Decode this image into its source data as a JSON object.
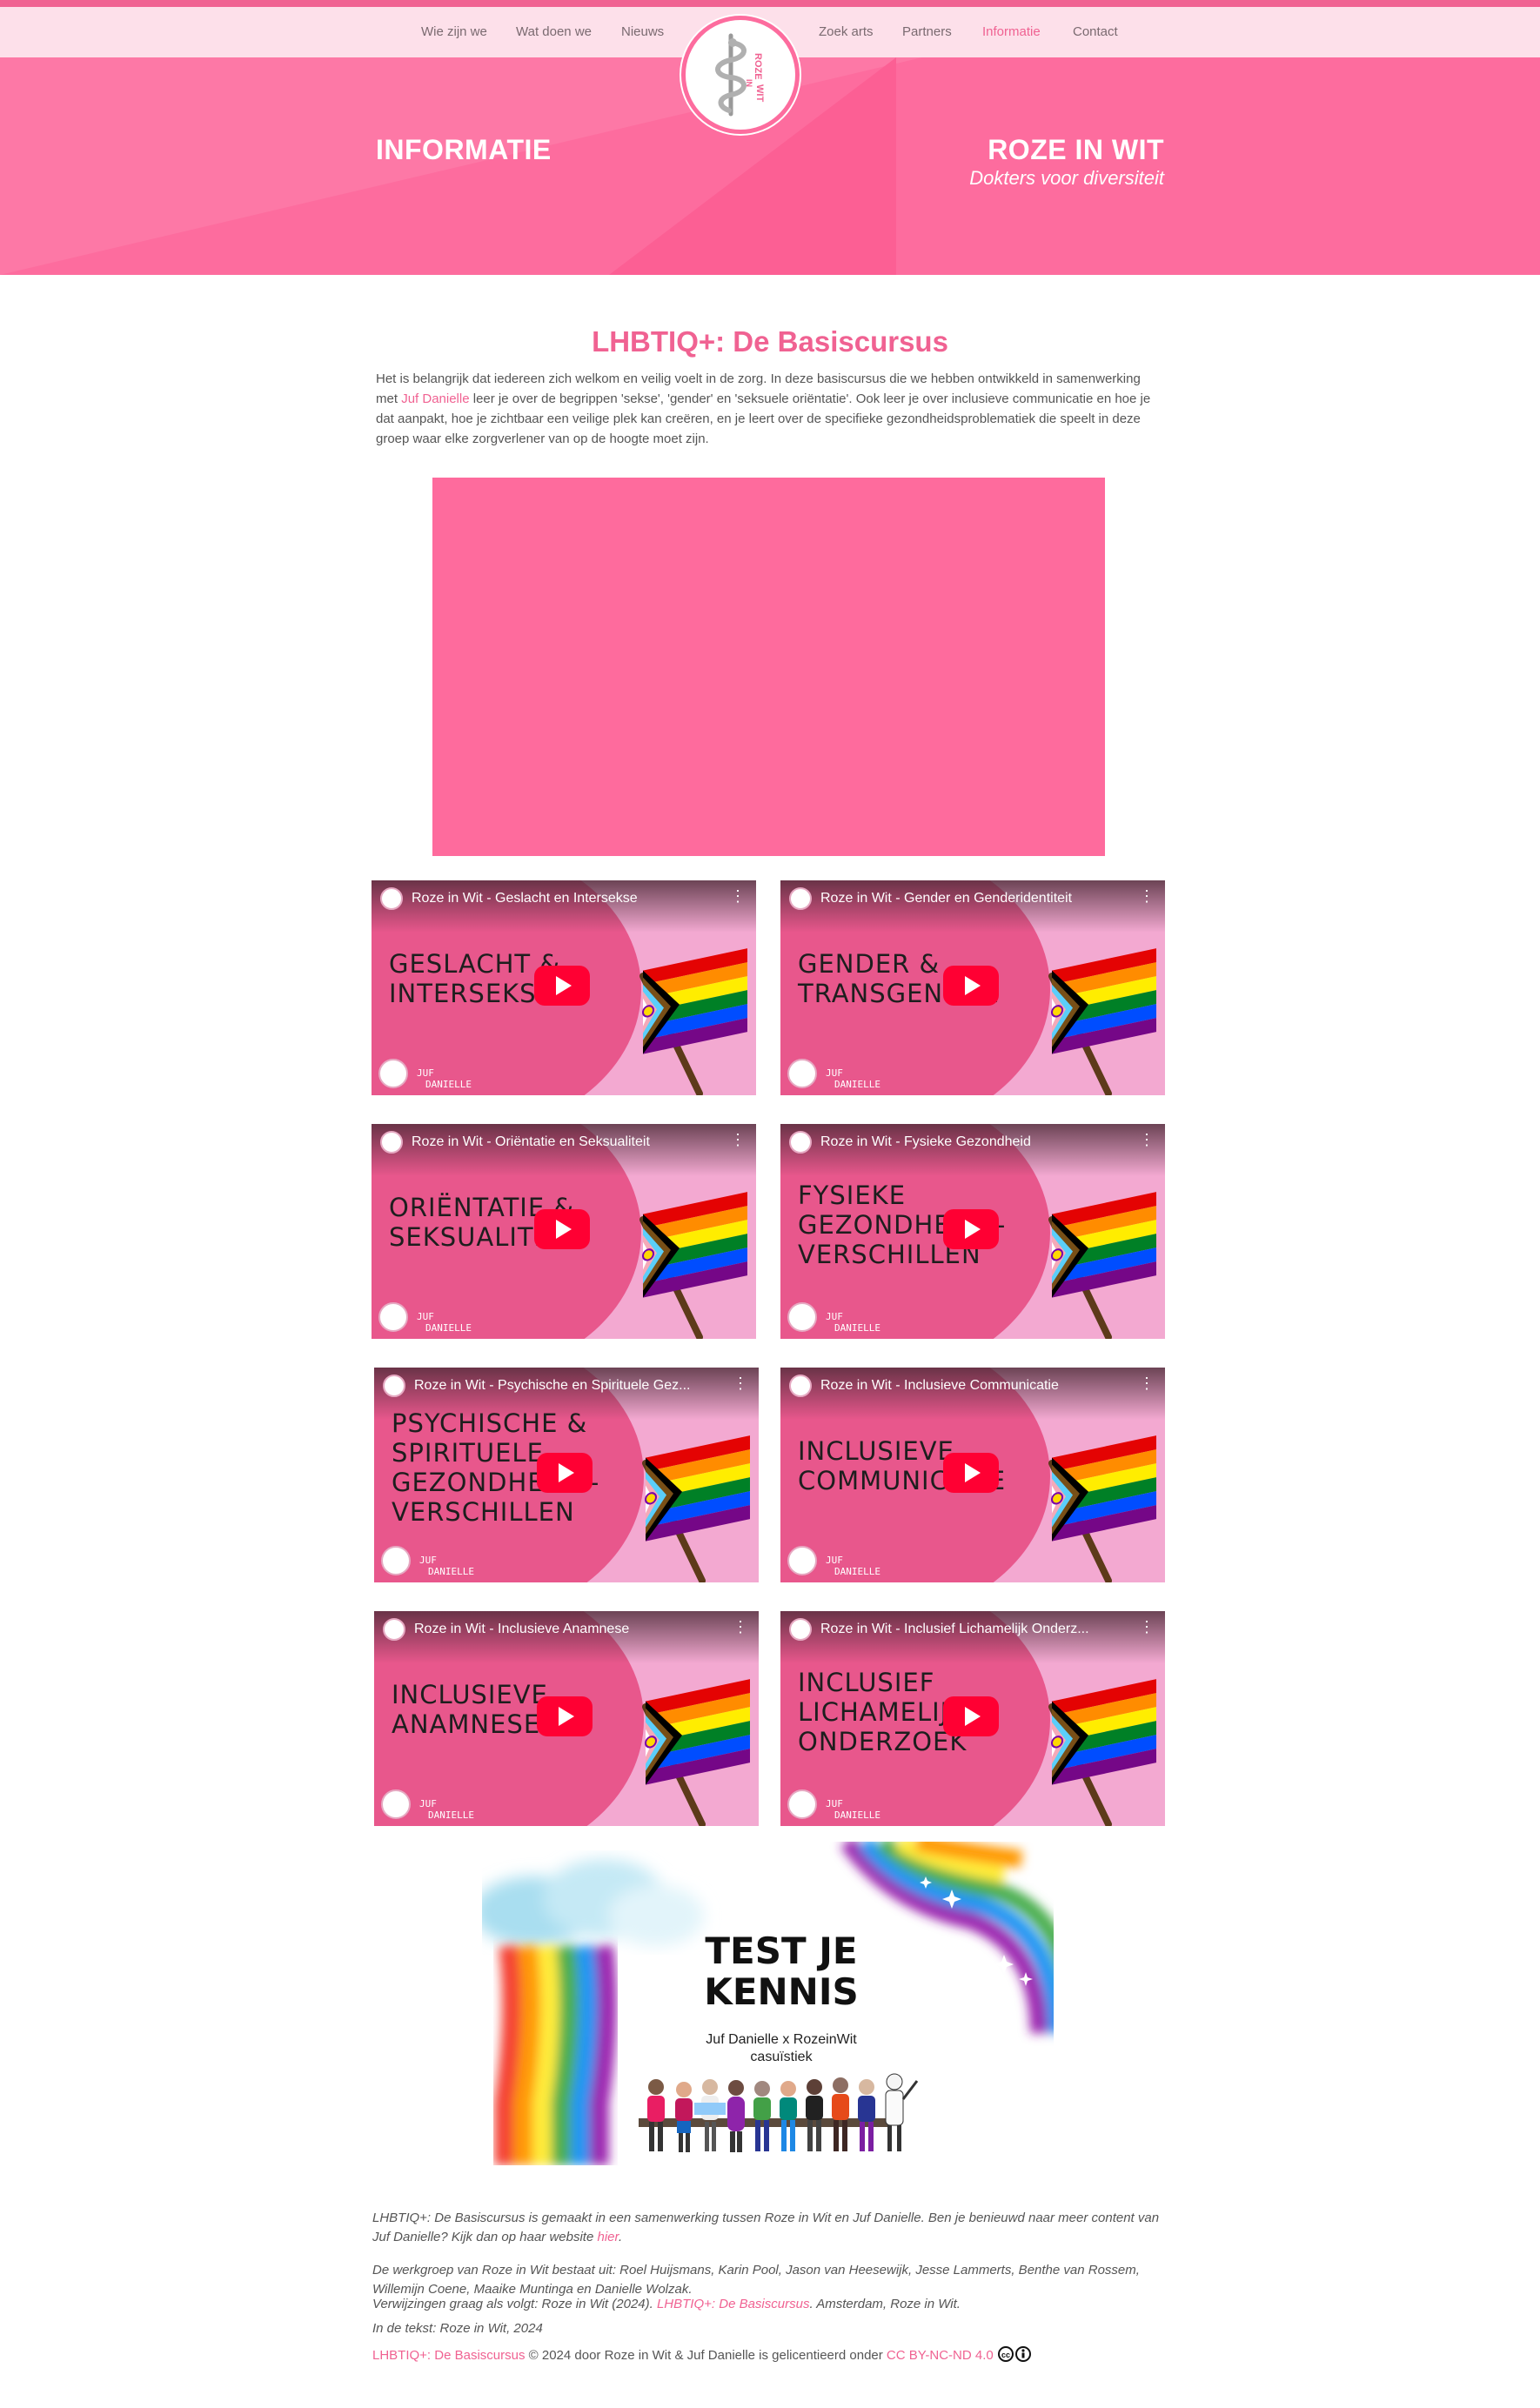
{
  "nav": {
    "left": [
      "Wie zijn we",
      "Wat doen we",
      "Nieuws"
    ],
    "right": [
      "Zoek arts",
      "Partners",
      "Informatie",
      "Contact"
    ],
    "active": "Informatie"
  },
  "logo": {
    "text_top": "ROZE",
    "text_mid": "IN",
    "text_bottom": "WIT"
  },
  "hero": {
    "left_title": "INFORMATIE",
    "right_title": "ROZE IN WIT",
    "right_subtitle": "Dokters voor diversiteit"
  },
  "colors": {
    "accent": "#f06292",
    "hero": "#fd6c9e",
    "nav_bg": "#fde0ea"
  },
  "main": {
    "title": "LHBTIQ+: De Basiscursus",
    "intro_before": "Het is belangrijk dat iedereen zich welkom en veilig voelt in de zorg. In deze basiscursus die we hebben ontwikkeld in samenwerking met ",
    "intro_link": "Juf Danielle",
    "intro_after": " leer je over de begrippen 'sekse', 'gender' en 'seksuele oriëntatie'. Ook leer je over inclusieve communicatie en hoe je dat aanpakt, hoe je zichtbaar een veilige plek kan creëren, en je leert over de specifieke gezondheidsproblematiek die speelt in deze groep waar elke zorgverlener van op de hoogte moet zijn."
  },
  "videos": [
    {
      "title": "Roze in Wit - Geslacht en Intersekse",
      "lines": [
        "GESLACHT &",
        "INTERSEKSE"
      ]
    },
    {
      "title": "Roze in Wit - Gender en Genderidentiteit",
      "lines": [
        "GENDER &",
        "TRANSGENDER"
      ]
    },
    {
      "title": "Roze in Wit - Oriëntatie en Seksualiteit",
      "lines": [
        "ORIËNTATIE &",
        "SEKSUALITEIT"
      ]
    },
    {
      "title": "Roze in Wit - Fysieke Gezondheid",
      "lines": [
        "FYSIEKE",
        "GEZONDHEIDS-",
        "VERSCHILLEN"
      ]
    },
    {
      "title": "Roze in Wit - Psychische en Spirituele Gez...",
      "lines": [
        "PSYCHISCHE &",
        "SPIRITUELE",
        "GEZONDHEIDS-",
        "VERSCHILLEN"
      ]
    },
    {
      "title": "Roze in Wit - Inclusieve Communicatie",
      "lines": [
        "INCLUSIEVE",
        "COMMUNICATIE"
      ]
    },
    {
      "title": "Roze in Wit - Inclusieve Anamnese",
      "lines": [
        "INCLUSIEVE",
        "ANAMNESE"
      ]
    },
    {
      "title": "Roze in Wit - Inclusief Lichamelijk Onderz...",
      "lines": [
        "INCLUSIEF",
        "LICHAMELIJK",
        "ONDERZOEK"
      ]
    }
  ],
  "video_brand": {
    "line1": "JUF",
    "line2": "DANIELLE"
  },
  "quiz": {
    "title_line1": "TEST JE",
    "title_line2": "KENNIS",
    "sub_line1": "Juf Danielle x RozeinWit",
    "sub_line2": "casuïstiek"
  },
  "credits": {
    "p1_before": "LHBTIQ+: De Basiscursus is gemaakt in een samenwerking tussen Roze in Wit en Juf Danielle.  Ben je benieuwd naar meer content van Juf Danielle? Kijk dan op haar website ",
    "p1_link": "hier",
    "p1_after": ".",
    "p2": "De werkgroep van Roze in Wit bestaat uit: Roel Huijsmans, Karin Pool, Jason van Heesewijk, Jesse Lammerts, Benthe van Rossem, Willemijn Coene, Maaike Muntinga en Danielle Wolzak.",
    "p3_before": "Verwijzingen graag als volgt: Roze in Wit (2024). ",
    "p3_link": "LHBTIQ+: De Basiscursus",
    "p3_after": ". Amsterdam, Roze in Wit.",
    "p4": "In de tekst: Roze in Wit, 2024"
  },
  "license": {
    "work": "LHBTIQ+: De Basiscursus",
    "middle": " © 2024 door Roze in Wit & Juf Danielle is gelicentieerd onder ",
    "license_link": "CC BY-NC-ND 4.0"
  }
}
